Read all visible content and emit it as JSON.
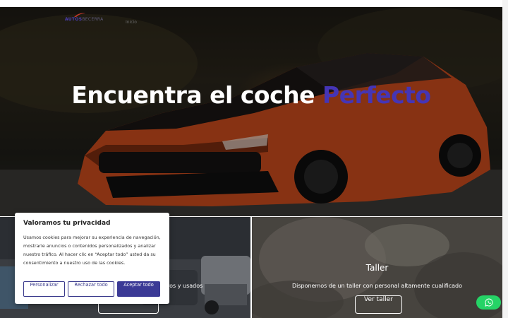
{
  "header": {
    "logo_main": "AUTOS",
    "logo_sub": "BECERRA",
    "nav_link": "Inicio"
  },
  "hero": {
    "title_main": "Encuentra el coche ",
    "title_accent": "Perfecto"
  },
  "panels": {
    "left": {
      "description_visible": "ros y usados",
      "button_label": "Ver vehículos"
    },
    "right": {
      "title": "Taller",
      "description": "Disponemos de un taller con personal altamente cualificado",
      "button_label": "Ver taller"
    }
  },
  "cookie_banner": {
    "title": "Valoramos tu privacidad",
    "text": "Usamos cookies para mejorar su experiencia de navegación, mostrarle anuncios o contenidos personalizados y analizar nuestro tráfico. Al hacer clic en “Aceptar todo” usted da su consentimiento a nuestro uso de las cookies.",
    "btn_customize": "Personalizar",
    "btn_reject": "Rechazar todo",
    "btn_accept": "Aceptar todo"
  },
  "whatsapp": {
    "icon": "whatsapp-icon"
  },
  "colors": {
    "accent": "#4535b6",
    "button_primary": "#3b3a96",
    "whatsapp": "#25d366"
  }
}
